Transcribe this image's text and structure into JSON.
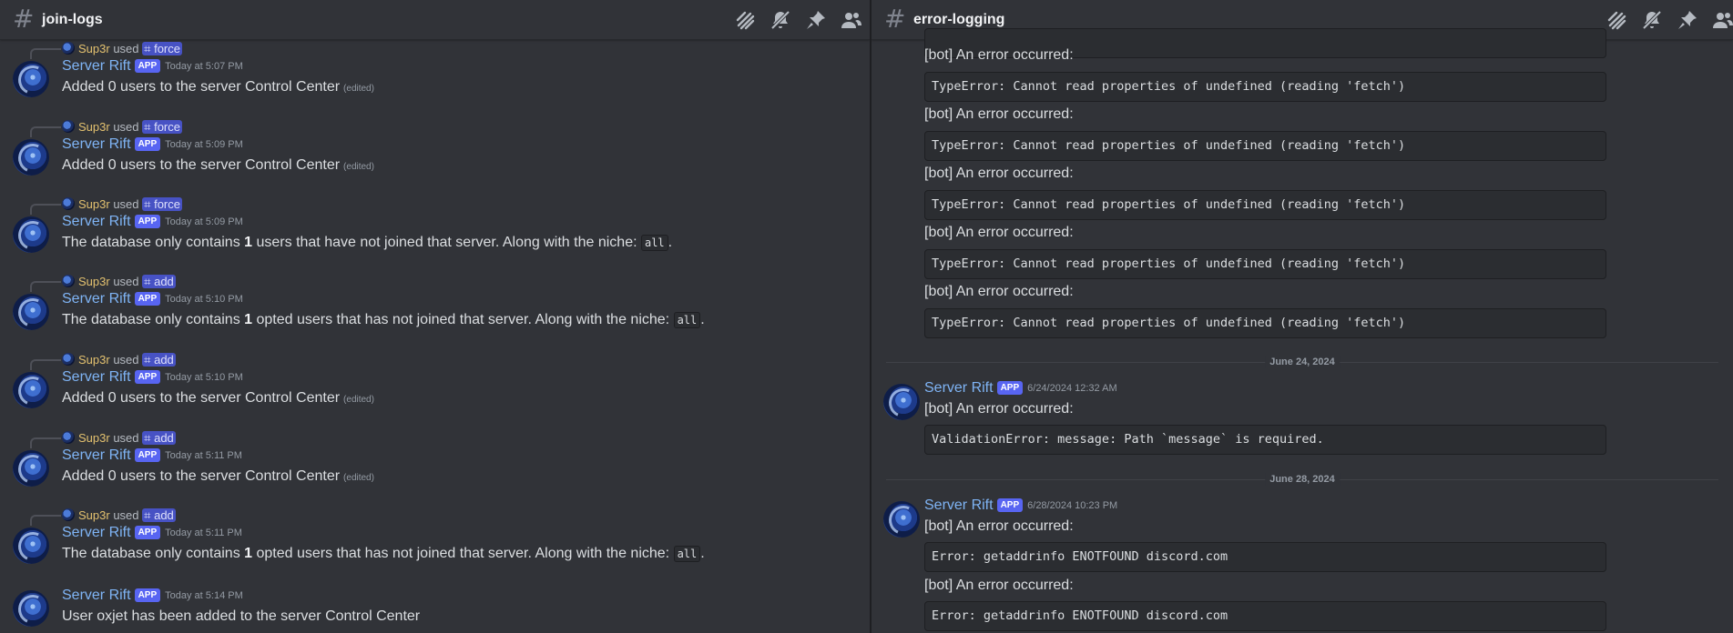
{
  "left": {
    "channel": "join-logs",
    "messages": [
      {
        "reply_user": "Sup3r",
        "used": "used",
        "command": "force",
        "author": "Server Rift",
        "badge": "APP",
        "time": "Today at 5:07 PM",
        "text": "Added 0 users to the server Control Center",
        "edited": "(edited)"
      },
      {
        "reply_user": "Sup3r",
        "used": "used",
        "command": "force",
        "author": "Server Rift",
        "badge": "APP",
        "time": "Today at 5:09 PM",
        "text": "Added 0 users to the server Control Center",
        "edited": "(edited)"
      },
      {
        "reply_user": "Sup3r",
        "used": "used",
        "command": "force",
        "author": "Server Rift",
        "badge": "APP",
        "time": "Today at 5:09 PM",
        "text_pre": "The database only contains ",
        "num": "1",
        "text_post": " users that have not joined that server. Along with the niche: ",
        "code": "all",
        "end": "."
      },
      {
        "reply_user": "Sup3r",
        "used": "used",
        "command": "add",
        "author": "Server Rift",
        "badge": "APP",
        "time": "Today at 5:10 PM",
        "text_pre": "The database only contains ",
        "num": "1",
        "text_post": " opted users that has not joined that server. Along with the niche: ",
        "code": "all",
        "end": "."
      },
      {
        "reply_user": "Sup3r",
        "used": "used",
        "command": "add",
        "author": "Server Rift",
        "badge": "APP",
        "time": "Today at 5:10 PM",
        "text": "Added 0 users to the server Control Center",
        "edited": "(edited)"
      },
      {
        "reply_user": "Sup3r",
        "used": "used",
        "command": "add",
        "author": "Server Rift",
        "badge": "APP",
        "time": "Today at 5:11 PM",
        "text": "Added 0 users to the server Control Center",
        "edited": "(edited)"
      },
      {
        "reply_user": "Sup3r",
        "used": "used",
        "command": "add",
        "author": "Server Rift",
        "badge": "APP",
        "time": "Today at 5:11 PM",
        "text_pre": "The database only contains ",
        "num": "1",
        "text_post": " opted users that has not joined that server. Along with the niche: ",
        "code": "all",
        "end": "."
      },
      {
        "author": "Server Rift",
        "badge": "APP",
        "time": "Today at 5:14 PM",
        "text": "User oxjet has been added to the server Control Center"
      }
    ]
  },
  "right": {
    "channel": "error-logging",
    "bot_line": "[bot] An error occurred:",
    "fetch_error": "TypeError: Cannot read properties of undefined (reading 'fetch')",
    "date1": "June 24, 2024",
    "msg1": {
      "author": "Server Rift",
      "badge": "APP",
      "time": "6/24/2024 12:32 AM",
      "line": "[bot] An error occurred:",
      "code": "ValidationError: message: Path `message` is required."
    },
    "date2": "June 28, 2024",
    "msg2": {
      "author": "Server Rift",
      "badge": "APP",
      "time": "6/28/2024 10:23 PM",
      "line": "[bot] An error occurred:",
      "code": "Error: getaddrinfo ENOTFOUND discord.com",
      "line2": "[bot] An error occurred:",
      "code2": "Error: getaddrinfo ENOTFOUND discord.com"
    }
  },
  "icons": [
    "threads-icon",
    "mute-icon",
    "pin-icon",
    "members-icon"
  ]
}
